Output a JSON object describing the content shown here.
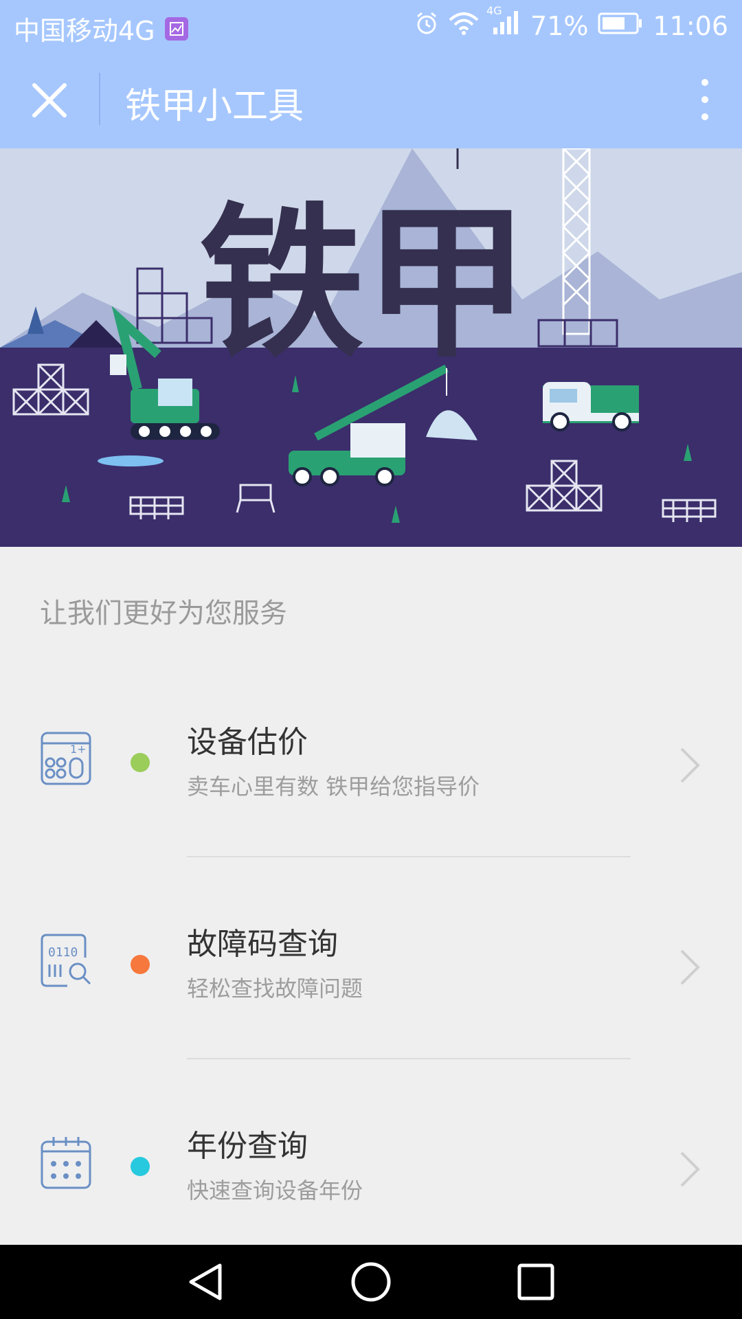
{
  "status_bar": {
    "carrier": "中国移动4G",
    "network_label": "4G",
    "battery": "71%",
    "time": "11:06",
    "icons": [
      "image-icon",
      "alarm-icon",
      "wifi-icon",
      "signal-icon",
      "battery-icon"
    ]
  },
  "nav": {
    "title": "铁甲小工具",
    "close_icon": "close-icon",
    "menu_icon": "more-vertical-icon"
  },
  "banner": {
    "headline": "铁甲"
  },
  "section": {
    "title": "让我们更好为您服务"
  },
  "items": [
    {
      "title": "设备估价",
      "subtitle": "卖车心里有数 铁甲给您指导价",
      "icon": "calculator-icon",
      "dot_color": "#9acd5a"
    },
    {
      "title": "故障码查询",
      "subtitle": "轻松查找故障问题",
      "icon": "barcode-search-icon",
      "dot_color": "#f6783c"
    },
    {
      "title": "年份查询",
      "subtitle": "快速查询设备年份",
      "icon": "calendar-icon",
      "dot_color": "#27c9de"
    }
  ],
  "colors": {
    "header_bg": "#a6c7fe",
    "banner_ground": "#3b2e6b",
    "icon_stroke": "#6a8fc4"
  },
  "system_nav": [
    "back-icon",
    "home-icon",
    "recents-icon"
  ]
}
